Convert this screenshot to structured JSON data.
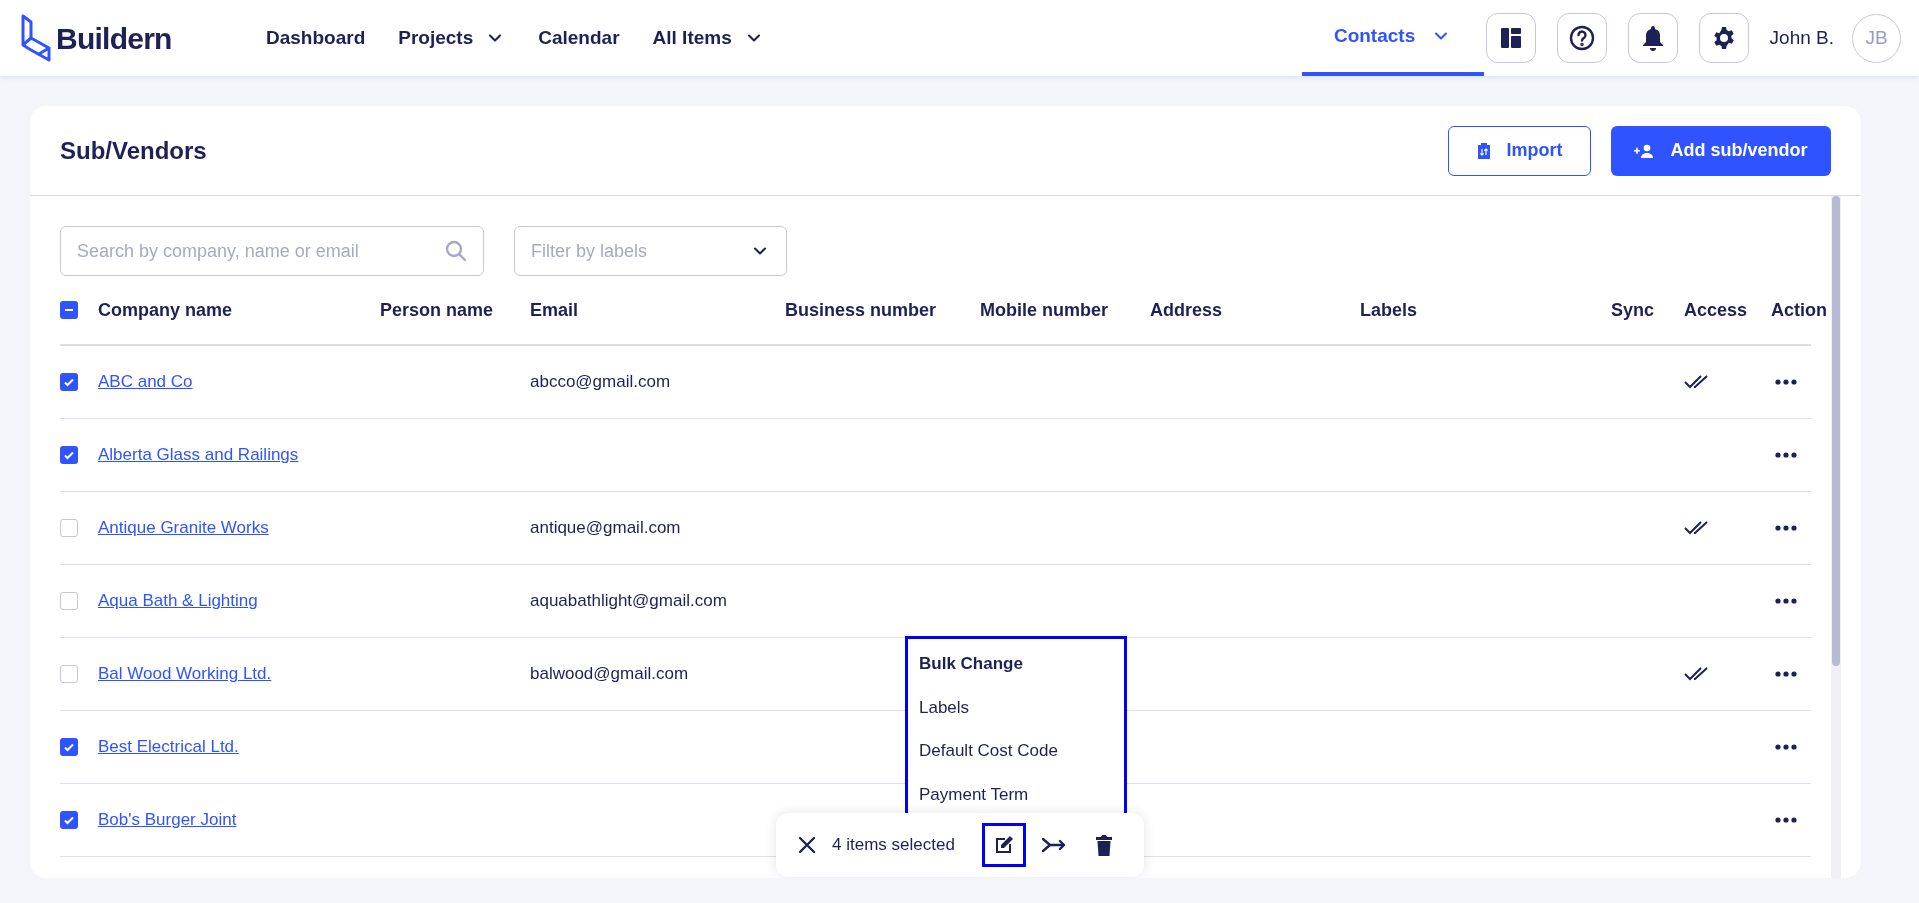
{
  "brand": "Buildern",
  "nav": [
    {
      "label": "Dashboard",
      "dropdown": false,
      "selected": false
    },
    {
      "label": "Projects",
      "dropdown": true,
      "selected": false
    },
    {
      "label": "Calendar",
      "dropdown": false,
      "selected": false
    },
    {
      "label": "All Items",
      "dropdown": true,
      "selected": false
    }
  ],
  "contacts_tab": {
    "label": "Contacts",
    "selected": true
  },
  "user": {
    "name": "John B.",
    "initials": "JB"
  },
  "page": {
    "title": "Sub/Vendors",
    "import_button": "Import",
    "add_button": "Add sub/vendor"
  },
  "search": {
    "placeholder": "Search by company, name or email"
  },
  "filter": {
    "placeholder": "Filter by labels"
  },
  "table": {
    "select_all_partial": true,
    "columns": [
      "Company name",
      "Person name",
      "Email",
      "Business number",
      "Mobile number",
      "Address",
      "Labels",
      "Sync",
      "Access",
      "Action"
    ],
    "rows": [
      {
        "company": "ABC and Co",
        "email": "abcco@gmail.com",
        "checked": true,
        "access": true
      },
      {
        "company": "Alberta Glass and Railings",
        "checked": true,
        "access": false
      },
      {
        "company": "Antique Granite Works",
        "email": "antique@gmail.com",
        "checked": false,
        "access": true
      },
      {
        "company": "Aqua Bath & Lighting",
        "email": "aquabathlight@gmail.com",
        "checked": false,
        "access": false
      },
      {
        "company": "Bal Wood Working Ltd.",
        "email": "balwood@gmail.com",
        "checked": false,
        "access": true
      },
      {
        "company": "Best Electrical Ltd.",
        "checked": true,
        "access": false
      },
      {
        "company": "Bob's Burger Joint",
        "checked": true,
        "access": false
      }
    ]
  },
  "bulk_menu": {
    "title": "Bulk Change",
    "items": [
      "Labels",
      "Default Cost Code",
      "Payment Term"
    ]
  },
  "selection_bar": {
    "count": "4 items selected",
    "actions": [
      {
        "kind": "edit",
        "selected": true
      },
      {
        "kind": "merge",
        "selected": false
      },
      {
        "kind": "delete",
        "selected": false
      }
    ]
  }
}
